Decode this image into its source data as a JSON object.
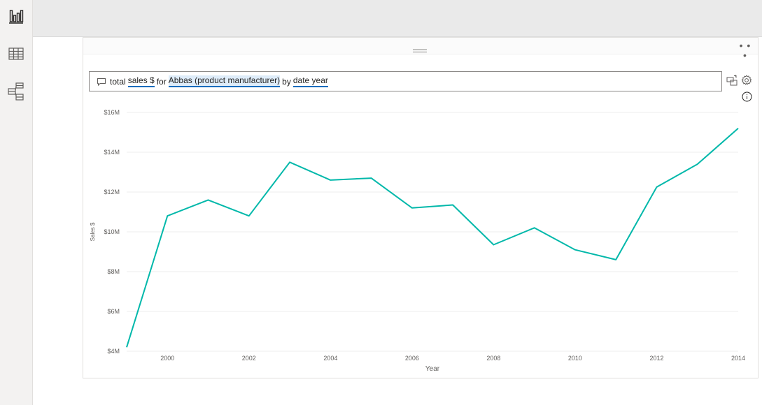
{
  "nav": {
    "items": [
      {
        "name": "report-view",
        "icon": "bar-chart-icon"
      },
      {
        "name": "data-view",
        "icon": "table-grid-icon"
      },
      {
        "name": "model-view",
        "icon": "model-diagram-icon"
      }
    ]
  },
  "visual": {
    "more_label": "• • •",
    "qa": {
      "icon": "speech-bubble-icon",
      "tokens": [
        {
          "text": "total",
          "kind": "plain"
        },
        {
          "text": "sales $",
          "kind": "term"
        },
        {
          "text": "for",
          "kind": "plain"
        },
        {
          "text": "Abbas (product manufacturer)",
          "kind": "term-highlight"
        },
        {
          "text": "by",
          "kind": "plain"
        },
        {
          "text": "date year",
          "kind": "term"
        }
      ]
    },
    "tools": {
      "convert_icon": "turn-into-visual-icon",
      "settings_icon": "gear-icon",
      "info_icon": "info-icon"
    }
  },
  "colors": {
    "line": "#01b8aa",
    "term_underline": "#0f6cbd",
    "term_highlight": "#deecf9"
  },
  "chart_data": {
    "type": "line",
    "xlabel": "Year",
    "ylabel": "Sales $",
    "x": [
      1999,
      2000,
      2001,
      2002,
      2003,
      2004,
      2005,
      2006,
      2007,
      2008,
      2009,
      2010,
      2011,
      2012,
      2013,
      2014
    ],
    "series": [
      {
        "values": [
          4.2,
          10.8,
          11.6,
          10.8,
          13.5,
          12.6,
          12.7,
          11.2,
          11.35,
          9.35,
          10.2,
          9.1,
          8.6,
          12.25,
          13.4,
          15.2
        ]
      }
    ],
    "y_unit": "$M",
    "ylim": [
      4,
      16
    ],
    "yticks": [
      "$4M",
      "$6M",
      "$8M",
      "$10M",
      "$12M",
      "$14M",
      "$16M"
    ],
    "ytick_values": [
      4,
      6,
      8,
      10,
      12,
      14,
      16
    ],
    "xticks": [
      "2000",
      "2002",
      "2004",
      "2006",
      "2008",
      "2010",
      "2012",
      "2014"
    ],
    "xtick_values": [
      2000,
      2002,
      2004,
      2006,
      2008,
      2010,
      2012,
      2014
    ],
    "grid": true,
    "legend": "none"
  }
}
